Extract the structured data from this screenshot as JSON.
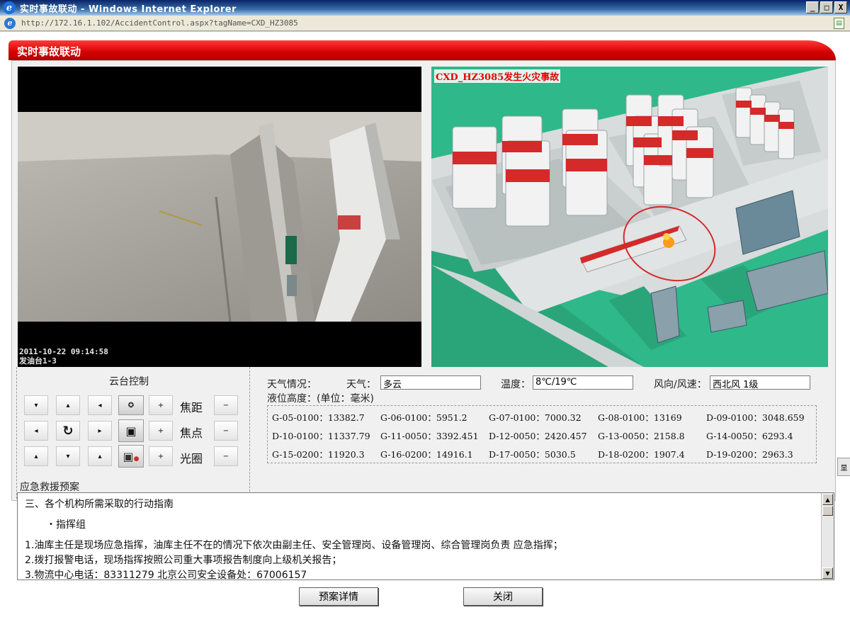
{
  "window": {
    "title": "实时事故联动 - Windows Internet Explorer",
    "url": "http://172.16.1.102/AccidentControl.aspx?tagName=CXD_HZ3085",
    "minimize": "_",
    "maximize": "□",
    "close": "X"
  },
  "header": {
    "title": "实时事故联动"
  },
  "video": {
    "timestamp": "2011-10-22 09:14:58",
    "camera": "发油台1-3"
  },
  "map": {
    "incident_label": "CXD_HZ3085发生火灾事故"
  },
  "ptz": {
    "title": "云台控制",
    "focal_label": "焦距",
    "focus_label": "焦点",
    "iris_label": "光圈",
    "plus": "+",
    "minus": "−"
  },
  "weather": {
    "section_label": "天气情况：",
    "weather_label": "天气：",
    "weather_value": "多云",
    "temp_label": "温度：",
    "temp_value": "8℃/19℃",
    "wind_label": "风向/风速：",
    "wind_value": "西北风 1级"
  },
  "levels": {
    "title": "液位高度：(单位：毫米)",
    "items": [
      "G-05-0100：13382.7",
      "G-06-0100：5951.2",
      "G-07-0100：7000.32",
      "G-08-0100：13169",
      "D-09-0100：3048.659",
      "D-10-0100：11337.79",
      "G-11-0050：3392.451",
      "D-12-0050：2420.457",
      "G-13-0050：2158.8",
      "G-14-0050：6293.4",
      "G-15-0200：11920.3",
      "G-16-0200：14916.1",
      "D-17-0050：5030.5",
      "D-18-0200：1907.4",
      "D-19-0200：2963.3"
    ]
  },
  "plan": {
    "title": "应急救援预案",
    "lines": [
      "三、各个机构所需采取的行动指南",
      "・指挥组",
      "1.油库主任是现场应急指挥，油库主任不在的情况下依次由副主任、安全管理岗、设备管理岗、综合管理岗负责 应急指挥；",
      "2.拨打报警电话，现场指挥按照公司重大事项报告制度向上级机关报告；",
      "3.物流中心电话：83311279 北京公司安全设备处：67006157"
    ]
  },
  "buttons": {
    "details": "预案详情",
    "close": "关闭"
  },
  "side_tab": "显"
}
